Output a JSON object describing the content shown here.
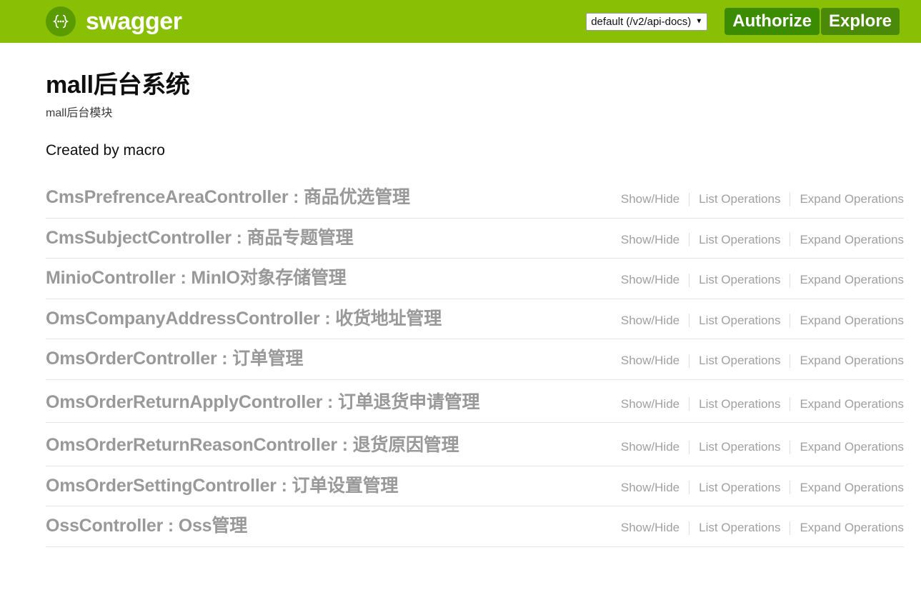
{
  "topbar": {
    "logo_text": "swagger",
    "logo_icon": "swagger-braces-icon",
    "api_select_value": "default (/v2/api-docs)",
    "api_select_caret": "▼",
    "authorize_label": "Authorize",
    "explore_label": "Explore",
    "background_color": "#89bf04",
    "button_color": "#3b8c00"
  },
  "info": {
    "title": "mall后台系统",
    "description": "mall后台模块",
    "created_by": "Created by macro"
  },
  "options": {
    "show_hide": "Show/Hide",
    "list_operations": "List Operations",
    "expand_operations": "Expand Operations"
  },
  "resources": [
    {
      "name": "CmsPrefrenceAreaController",
      "separator": " : ",
      "title": "商品优选管理",
      "wrapped": false
    },
    {
      "name": "CmsSubjectController",
      "separator": " : ",
      "title": "商品专题管理",
      "wrapped": false
    },
    {
      "name": "MinioController",
      "separator": " : ",
      "title": "MinIO对象存储管理",
      "wrapped": false
    },
    {
      "name": "OmsCompanyAddressController",
      "separator": " : ",
      "title": "收货地址管理",
      "wrapped": false
    },
    {
      "name": "OmsOrderController",
      "separator": " : ",
      "title": "订单管理",
      "wrapped": false
    },
    {
      "name": "OmsOrderReturnApplyController",
      "separator": " : ",
      "title": "订单退货申请管理",
      "wrapped": true
    },
    {
      "name": "OmsOrderReturnReasonController",
      "separator": " : ",
      "title": "退货原因管理",
      "wrapped": true
    },
    {
      "name": "OmsOrderSettingController",
      "separator": " : ",
      "title": "订单设置管理",
      "wrapped": false
    },
    {
      "name": "OssController",
      "separator": " : ",
      "title": "Oss管理",
      "wrapped": false
    }
  ]
}
